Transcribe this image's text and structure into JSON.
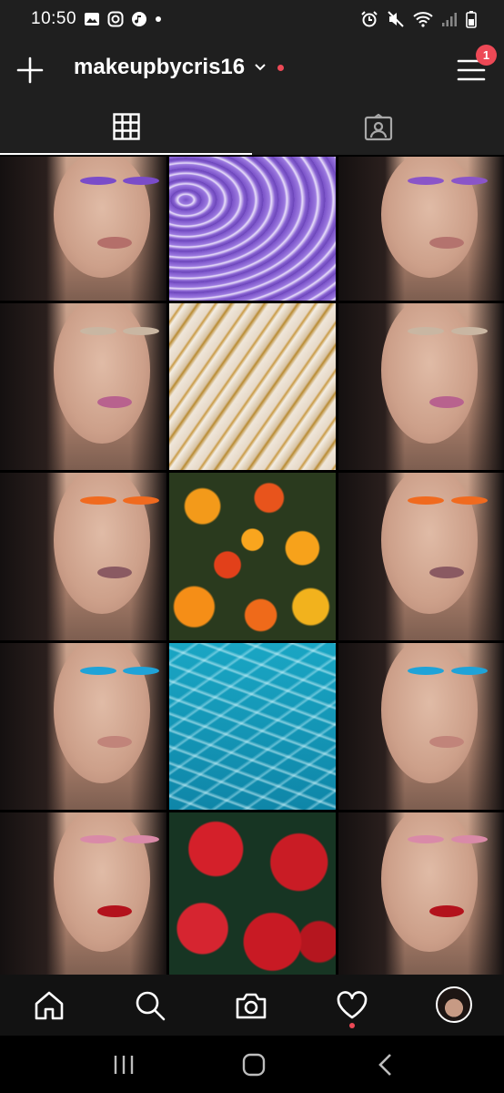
{
  "status_bar": {
    "time": "10:50",
    "left_icons": [
      "gallery-icon",
      "instagram-icon",
      "music-icon",
      "dot-icon"
    ],
    "right_icons": [
      "alarm-icon",
      "mute-icon",
      "wifi-icon",
      "signal-icon",
      "battery-icon"
    ]
  },
  "header": {
    "username": "makeupbycris16",
    "menu_badge": "1"
  },
  "tabs": [
    "grid-icon",
    "tagged-icon"
  ],
  "posts": [
    {
      "type": "selfie",
      "eyeshadow": "#7a4cc9",
      "lips": "#b46f6a"
    },
    {
      "type": "agate"
    },
    {
      "type": "selfie",
      "eyeshadow": "#8a55c8",
      "lips": "#b4736e"
    },
    {
      "type": "selfie",
      "eyeshadow": "#c9b6a2",
      "lips": "#b8628e"
    },
    {
      "type": "marble"
    },
    {
      "type": "selfie",
      "eyeshadow": "#c9b6a2",
      "lips": "#b8628e"
    },
    {
      "type": "selfie",
      "eyeshadow": "#f06a1f",
      "lips": "#8a5a62"
    },
    {
      "type": "flowers"
    },
    {
      "type": "selfie",
      "eyeshadow": "#f06a1f",
      "lips": "#8a5a62"
    },
    {
      "type": "selfie",
      "eyeshadow": "#1fa3d8",
      "lips": "#c1847a"
    },
    {
      "type": "water"
    },
    {
      "type": "selfie",
      "eyeshadow": "#1fa3d8",
      "lips": "#c1847a"
    },
    {
      "type": "selfie",
      "eyeshadow": "#d98aa8",
      "lips": "#b3121c"
    },
    {
      "type": "roses"
    },
    {
      "type": "selfie",
      "eyeshadow": "#d98aa8",
      "lips": "#b3121c"
    }
  ],
  "bottom_nav": [
    "home-icon",
    "search-icon",
    "camera-icon",
    "heart-icon",
    "profile-avatar"
  ],
  "system_nav": [
    "recents-icon",
    "home-button-icon",
    "back-icon"
  ],
  "colors": {
    "accent_red": "#ed4956",
    "header_bg": "#1f1f1f"
  }
}
